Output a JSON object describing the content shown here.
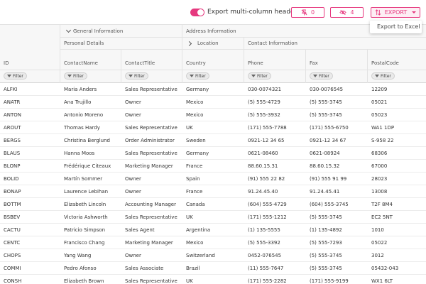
{
  "toolbar": {
    "toggle_label": "Export multi-column headers",
    "toggle_on": true,
    "pin_count": "0",
    "hide_count": "4",
    "export_label": "EXPORT",
    "accent": "#e6397f"
  },
  "dropdown": {
    "items": [
      "Export to Excel"
    ]
  },
  "groups": {
    "general": "General Information",
    "address": "Address Information",
    "personal": "Personal Details",
    "location": "Location",
    "contact": "Contact Information"
  },
  "columns": [
    "ID",
    "ContactName",
    "ContactTitle",
    "Country",
    "Phone",
    "Fax",
    "PostalCode"
  ],
  "filter_label": "Filter",
  "rows": [
    [
      "ALFKI",
      "Maria Anders",
      "Sales Representative",
      "Germany",
      "030-0074321",
      "030-0076545",
      "12209"
    ],
    [
      "ANATR",
      "Ana Trujillo",
      "Owner",
      "Mexico",
      "(5) 555-4729",
      "(5) 555-3745",
      "05021"
    ],
    [
      "ANTON",
      "Antonio Moreno",
      "Owner",
      "Mexico",
      "(5) 555-3932",
      "(5) 555-3745",
      "05023"
    ],
    [
      "AROUT",
      "Thomas Hardy",
      "Sales Representative",
      "UK",
      "(171) 555-7788",
      "(171) 555-6750",
      "WA1 1DP"
    ],
    [
      "BERGS",
      "Christina Berglund",
      "Order Administrator",
      "Sweden",
      "0921-12 34 65",
      "0921-12 34 67",
      "S-958 22"
    ],
    [
      "BLAUS",
      "Hanna Moos",
      "Sales Representative",
      "Germany",
      "0621-08460",
      "0621-08924",
      "68306"
    ],
    [
      "BLONP",
      "Frédérique Citeaux",
      "Marketing Manager",
      "France",
      "88.60.15.31",
      "88.60.15.32",
      "67000"
    ],
    [
      "BOLID",
      "Martín Sommer",
      "Owner",
      "Spain",
      "(91) 555 22 82",
      "(91) 555 91 99",
      "28023"
    ],
    [
      "BONAP",
      "Laurence Lebihan",
      "Owner",
      "France",
      "91.24.45.40",
      "91.24.45.41",
      "13008"
    ],
    [
      "BOTTM",
      "Elizabeth Lincoln",
      "Accounting Manager",
      "Canada",
      "(604) 555-4729",
      "(604) 555-3745",
      "T2F 8M4"
    ],
    [
      "BSBEV",
      "Victoria Ashworth",
      "Sales Representative",
      "UK",
      "(171) 555-1212",
      "(5) 555-3745",
      "EC2 5NT"
    ],
    [
      "CACTU",
      "Patricio Simpson",
      "Sales Agent",
      "Argentina",
      "(1) 135-5555",
      "(1) 135-4892",
      "1010"
    ],
    [
      "CENTC",
      "Francisco Chang",
      "Marketing Manager",
      "Mexico",
      "(5) 555-3392",
      "(5) 555-7293",
      "05022"
    ],
    [
      "CHOPS",
      "Yang Wang",
      "Owner",
      "Switzerland",
      "0452-076545",
      "(5) 555-3745",
      "3012"
    ],
    [
      "COMMI",
      "Pedro Afonso",
      "Sales Associate",
      "Brazil",
      "(11) 555-7647",
      "(5) 555-3745",
      "05432-043"
    ],
    [
      "CONSH",
      "Elizabeth Brown",
      "Sales Representative",
      "UK",
      "(171) 555-2282",
      "(171) 555-9199",
      "WX1 6LT"
    ]
  ]
}
